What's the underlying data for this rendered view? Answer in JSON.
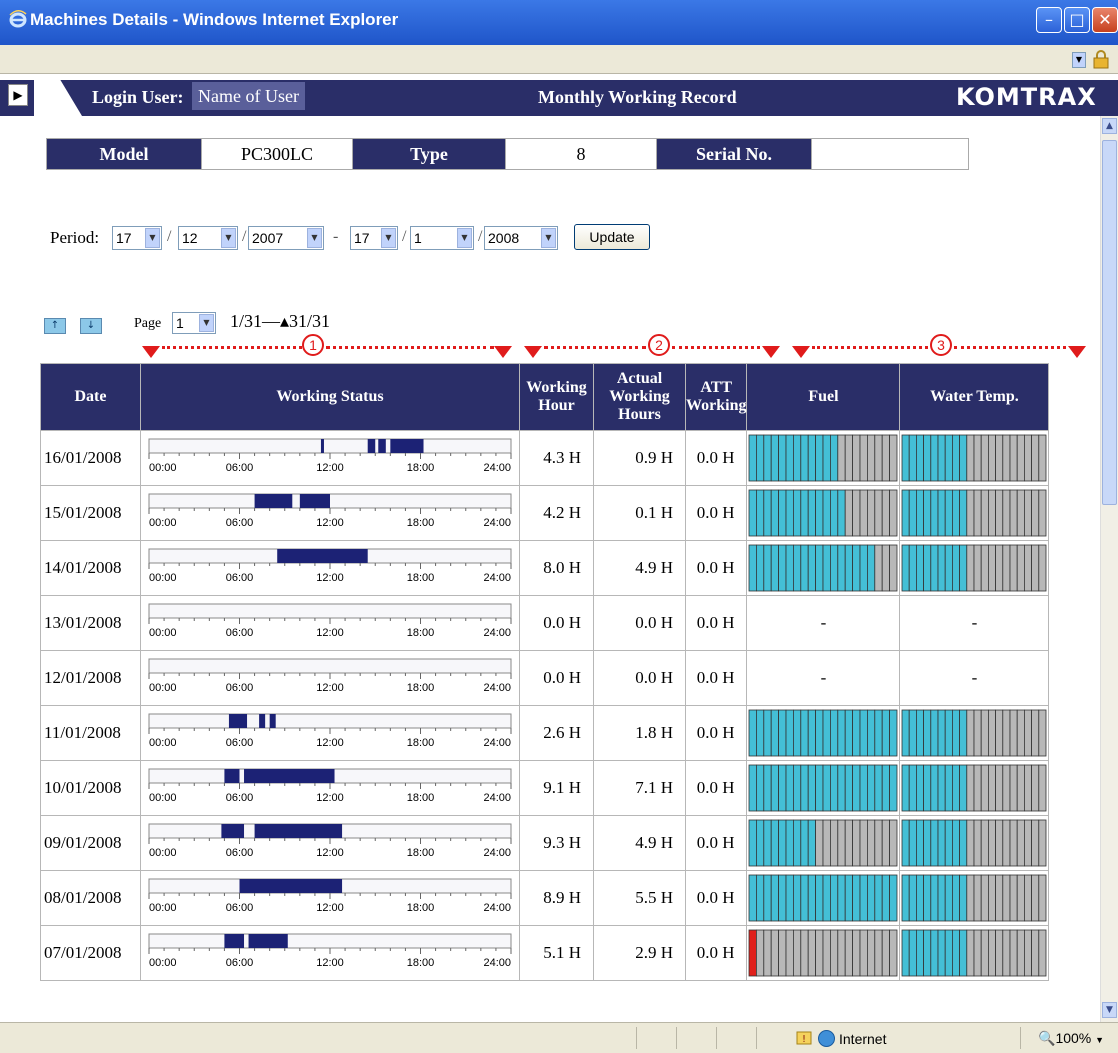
{
  "window": {
    "title": "Machines Details - Windows Internet Explorer"
  },
  "header": {
    "login_label": "Login User:",
    "login_name": "Name of User",
    "page_title": "Monthly Working Record",
    "brand": "KOMTRAX"
  },
  "info": {
    "model_label": "Model",
    "model_value": "PC300LC",
    "type_label": "Type",
    "type_value": "8",
    "serial_label": "Serial No.",
    "serial_value": ""
  },
  "period": {
    "label": "Period:",
    "from_day": "17",
    "from_month": "12",
    "from_year": "2007",
    "separator": "-",
    "to_day": "17",
    "to_month": "1",
    "to_year": "2008",
    "update_label": "Update"
  },
  "paging": {
    "page_label": "Page",
    "page_value": "1",
    "range": "1/31―▴31/31"
  },
  "markers": {
    "m1": "1",
    "m2": "2",
    "m3": "3"
  },
  "columns": {
    "date": "Date",
    "working_status": "Working Status",
    "working_hour": [
      "Working",
      "Hour"
    ],
    "actual_working_hours": [
      "Actual",
      "Working",
      "Hours"
    ],
    "att_working": [
      "ATT",
      "Working"
    ],
    "fuel": "Fuel",
    "water_temp": "Water Temp."
  },
  "timeline_ticks": [
    "00:00",
    "06:00",
    "12:00",
    "18:00",
    "24:00"
  ],
  "rows": [
    {
      "date": "16/01/2008",
      "segments": [
        [
          11.4,
          11.6
        ],
        [
          14.5,
          15.0
        ],
        [
          15.2,
          15.7
        ],
        [
          16.0,
          18.2
        ]
      ],
      "working_hour": "4.3 H",
      "actual": "0.9 H",
      "att": "0.0 H",
      "fuel": 0.6,
      "water": 0.46,
      "fuel_text": "",
      "water_text": ""
    },
    {
      "date": "15/01/2008",
      "segments": [
        [
          7.0,
          9.5
        ],
        [
          10.0,
          12.0
        ]
      ],
      "working_hour": "4.2 H",
      "actual": "0.1 H",
      "att": "0.0 H",
      "fuel": 0.67,
      "water": 0.46,
      "fuel_text": "",
      "water_text": ""
    },
    {
      "date": "14/01/2008",
      "segments": [
        [
          8.5,
          14.5
        ]
      ],
      "working_hour": "8.0 H",
      "actual": "4.9 H",
      "att": "0.0 H",
      "fuel": 0.87,
      "water": 0.46,
      "fuel_text": "",
      "water_text": ""
    },
    {
      "date": "13/01/2008",
      "segments": [],
      "working_hour": "0.0 H",
      "actual": "0.0 H",
      "att": "0.0 H",
      "fuel": null,
      "water": null,
      "fuel_text": "-",
      "water_text": "-"
    },
    {
      "date": "12/01/2008",
      "segments": [],
      "working_hour": "0.0 H",
      "actual": "0.0 H",
      "att": "0.0 H",
      "fuel": null,
      "water": null,
      "fuel_text": "-",
      "water_text": "-"
    },
    {
      "date": "11/01/2008",
      "segments": [
        [
          5.3,
          6.5
        ],
        [
          7.3,
          7.7
        ],
        [
          8.0,
          8.4
        ]
      ],
      "working_hour": "2.6 H",
      "actual": "1.8 H",
      "att": "0.0 H",
      "fuel": 1.0,
      "water": 0.46,
      "fuel_text": "",
      "water_text": ""
    },
    {
      "date": "10/01/2008",
      "segments": [
        [
          5.0,
          6.0
        ],
        [
          6.3,
          12.3
        ]
      ],
      "working_hour": "9.1 H",
      "actual": "7.1 H",
      "att": "0.0 H",
      "fuel": 1.0,
      "water": 0.46,
      "fuel_text": "",
      "water_text": ""
    },
    {
      "date": "09/01/2008",
      "segments": [
        [
          4.8,
          6.3
        ],
        [
          7.0,
          12.8
        ]
      ],
      "working_hour": "9.3 H",
      "actual": "4.9 H",
      "att": "0.0 H",
      "fuel": 0.46,
      "water": 0.46,
      "fuel_text": "",
      "water_text": ""
    },
    {
      "date": "08/01/2008",
      "segments": [
        [
          6.0,
          12.8
        ]
      ],
      "working_hour": "8.9 H",
      "actual": "5.5 H",
      "att": "0.0 H",
      "fuel": 1.0,
      "water": 0.46,
      "fuel_text": "",
      "water_text": ""
    },
    {
      "date": "07/01/2008",
      "segments": [
        [
          5.0,
          6.3
        ],
        [
          6.6,
          9.2
        ]
      ],
      "working_hour": "5.1 H",
      "actual": "2.9 H",
      "att": "0.0 H",
      "fuel": 0.07,
      "water": 0.46,
      "fuel_text": "",
      "water_text": "",
      "fuel_low": true
    }
  ],
  "status_bar": {
    "zone": "Internet",
    "zoom": "100%"
  },
  "colors": {
    "navy": "#2a2e68",
    "bar": "#1c2275",
    "gauge_fill": "#44bfd6",
    "gauge_empty": "#b8b8b8",
    "gauge_low": "#e0201b",
    "marker": "#e01b1b"
  }
}
